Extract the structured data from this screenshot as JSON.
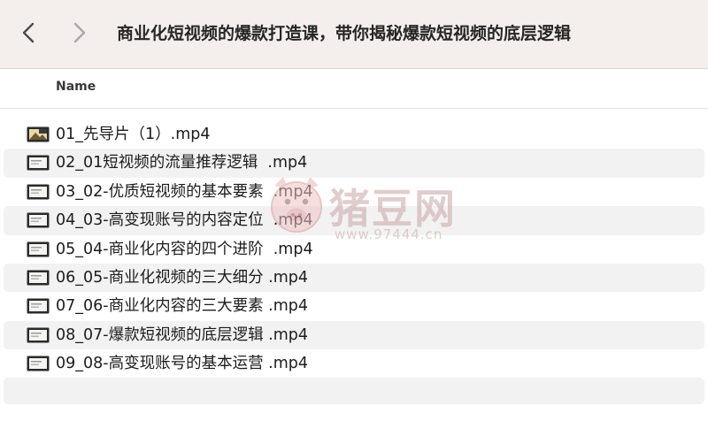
{
  "toolbar": {
    "title": "商业化短视频的爆款打造课，带你揭秘爆款短视频的底层逻辑",
    "back_icon": "chevron-left-icon",
    "forward_icon": "chevron-right-icon"
  },
  "columns": {
    "name": "Name"
  },
  "files": [
    {
      "name": "01_先导片（1）.mp4",
      "icon": "video-file-icon"
    },
    {
      "name": "02_01短视频的流量推荐逻辑  .mp4",
      "icon": "video-file-icon"
    },
    {
      "name": "03_02-优质短视频的基本要素  .mp4",
      "icon": "video-file-icon"
    },
    {
      "name": "04_03-高变现账号的内容定位  .mp4",
      "icon": "video-file-icon"
    },
    {
      "name": "05_04-商业化内容的四个进阶  .mp4",
      "icon": "video-file-icon"
    },
    {
      "name": "06_05-商业化视频的三大细分 .mp4",
      "icon": "video-file-icon"
    },
    {
      "name": "07_06-商业化内容的三大要素 .mp4",
      "icon": "video-file-icon"
    },
    {
      "name": "08_07-爆款短视频的底层逻辑 .mp4",
      "icon": "video-file-icon"
    },
    {
      "name": "09_08-高变现账号的基本运营 .mp4",
      "icon": "video-file-icon"
    }
  ],
  "watermark": {
    "logo_text": "猪豆网",
    "url": "www.97444.cn"
  },
  "colors": {
    "toolbar_bg": "#f4efec",
    "row_alt_bg": "#f2f2f2",
    "text": "#1c1c1c",
    "watermark": "#c9a5a5"
  }
}
